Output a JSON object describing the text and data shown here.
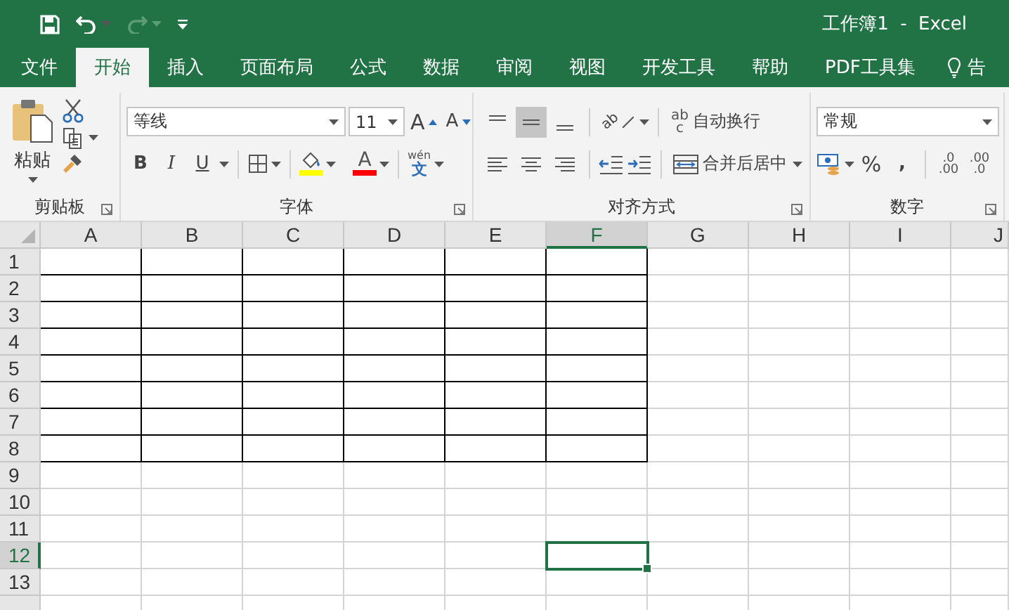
{
  "title_bar": {
    "quick_access": [
      {
        "kind": "save",
        "disabled": false
      },
      {
        "kind": "undo",
        "disabled": false
      },
      {
        "kind": "redo",
        "disabled": true
      },
      {
        "kind": "customize",
        "disabled": false
      }
    ],
    "title": "工作簿1  -  Excel"
  },
  "tabs": [
    {
      "label": "文件",
      "selected": false
    },
    {
      "label": "开始",
      "selected": true
    },
    {
      "label": "插入",
      "selected": false
    },
    {
      "label": "页面布局",
      "selected": false
    },
    {
      "label": "公式",
      "selected": false
    },
    {
      "label": "数据",
      "selected": false
    },
    {
      "label": "审阅",
      "selected": false
    },
    {
      "label": "视图",
      "selected": false
    },
    {
      "label": "开发工具",
      "selected": false
    },
    {
      "label": "帮助",
      "selected": false
    },
    {
      "label": "PDF工具集",
      "selected": false
    }
  ],
  "tell_me": {
    "label": "告"
  },
  "ribbon": {
    "clipboard": {
      "paste": "粘贴",
      "label": "剪贴板"
    },
    "font": {
      "font_name": "等线",
      "font_size": "11",
      "grow": "A",
      "shrink": "A",
      "bold": "B",
      "italic": "I",
      "underline": "U",
      "font_color": "A",
      "phonetic_top": "wén",
      "phonetic_bottom": "文",
      "label": "字体"
    },
    "alignment": {
      "buttons": [
        {
          "kind": "top",
          "selected": false
        },
        {
          "kind": "middle",
          "selected": true
        },
        {
          "kind": "bottom",
          "selected": false
        },
        {
          "kind": "left",
          "selected": false
        },
        {
          "kind": "center",
          "selected": false
        },
        {
          "kind": "right",
          "selected": false
        }
      ],
      "orientation": "ab",
      "wrap_icon_top": "ab",
      "wrap_icon_bottom": "c",
      "wrap_text": "自动换行",
      "merge": "合并后居中",
      "label": "对齐方式"
    },
    "number": {
      "format": "常规",
      "percent": "%",
      "comma": ",",
      "increase_top": ".0",
      "increase_bottom": ".00",
      "decrease_top": ".00",
      "decrease_bottom": ".0",
      "label": "数字"
    }
  },
  "sheet": {
    "columns": [
      {
        "label": "A",
        "selected": false,
        "bordered": true
      },
      {
        "label": "B",
        "selected": false,
        "bordered": true
      },
      {
        "label": "C",
        "selected": false,
        "bordered": true
      },
      {
        "label": "D",
        "selected": false,
        "bordered": true
      },
      {
        "label": "E",
        "selected": false,
        "bordered": true
      },
      {
        "label": "F",
        "selected": true,
        "bordered": true
      },
      {
        "label": "G",
        "selected": false,
        "bordered": false
      },
      {
        "label": "H",
        "selected": false,
        "bordered": false
      },
      {
        "label": "I",
        "selected": false,
        "bordered": false
      },
      {
        "label": "J",
        "selected": false,
        "bordered": false
      }
    ],
    "rows": [
      {
        "label": "1",
        "selected": false,
        "bordered": true
      },
      {
        "label": "2",
        "selected": false,
        "bordered": true
      },
      {
        "label": "3",
        "selected": false,
        "bordered": true
      },
      {
        "label": "4",
        "selected": false,
        "bordered": true
      },
      {
        "label": "5",
        "selected": false,
        "bordered": true
      },
      {
        "label": "6",
        "selected": false,
        "bordered": true
      },
      {
        "label": "7",
        "selected": false,
        "bordered": true
      },
      {
        "label": "8",
        "selected": false,
        "bordered": true
      },
      {
        "label": "9",
        "selected": false,
        "bordered": false
      },
      {
        "label": "10",
        "selected": false,
        "bordered": false
      },
      {
        "label": "11",
        "selected": false,
        "bordered": false
      },
      {
        "label": "12",
        "selected": true,
        "bordered": false
      },
      {
        "label": "13",
        "selected": false,
        "bordered": false
      }
    ]
  }
}
